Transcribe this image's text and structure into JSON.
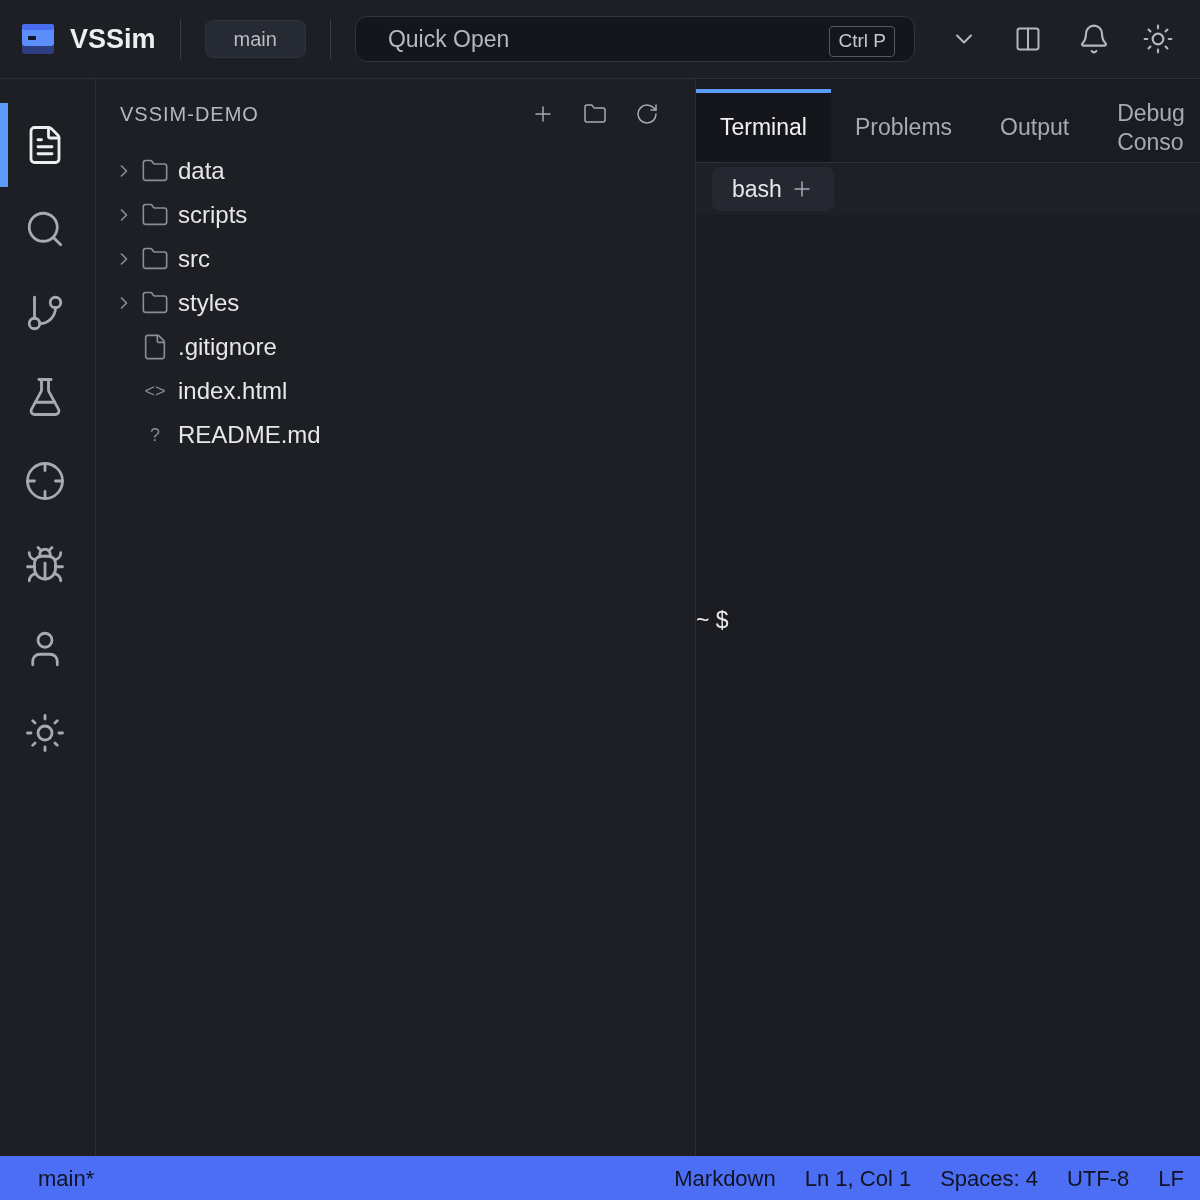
{
  "header": {
    "app_name": "VSSim",
    "branch": "main",
    "quick_open": {
      "placeholder": "Quick Open",
      "shortcut": "Ctrl P"
    }
  },
  "activity_bar": [
    {
      "kind": "explorer",
      "selected": true
    },
    {
      "kind": "search",
      "selected": false
    },
    {
      "kind": "source-control",
      "selected": false
    },
    {
      "kind": "run",
      "selected": false
    },
    {
      "kind": "debug",
      "selected": false
    },
    {
      "kind": "extensions",
      "selected": false
    },
    {
      "kind": "account",
      "selected": false
    },
    {
      "kind": "settings",
      "selected": false
    }
  ],
  "explorer": {
    "title": "VSSIM-DEMO",
    "items": [
      {
        "name": "data",
        "kind": "folder",
        "expanded": false
      },
      {
        "name": "scripts",
        "kind": "folder",
        "expanded": false
      },
      {
        "name": "src",
        "kind": "folder",
        "expanded": false
      },
      {
        "name": "styles",
        "kind": "folder",
        "expanded": false
      },
      {
        "name": ".gitignore",
        "kind": "file"
      },
      {
        "name": "index.html",
        "kind": "glyph",
        "glyph": "<>"
      },
      {
        "name": "README.md",
        "kind": "glyph",
        "glyph": "?"
      }
    ]
  },
  "panel": {
    "tabs": [
      {
        "label": "Terminal",
        "selected": true
      },
      {
        "label": "Problems",
        "selected": false
      },
      {
        "label": "Output",
        "selected": false
      },
      {
        "label": "Debug Conso",
        "selected": false
      }
    ],
    "terminal_tab": "bash",
    "prompt": "~ $"
  },
  "status_bar": {
    "branch": "main*",
    "items": [
      "Markdown",
      "Ln 1, Col 1",
      "Spaces: 4",
      "UTF-8",
      "LF"
    ]
  }
}
